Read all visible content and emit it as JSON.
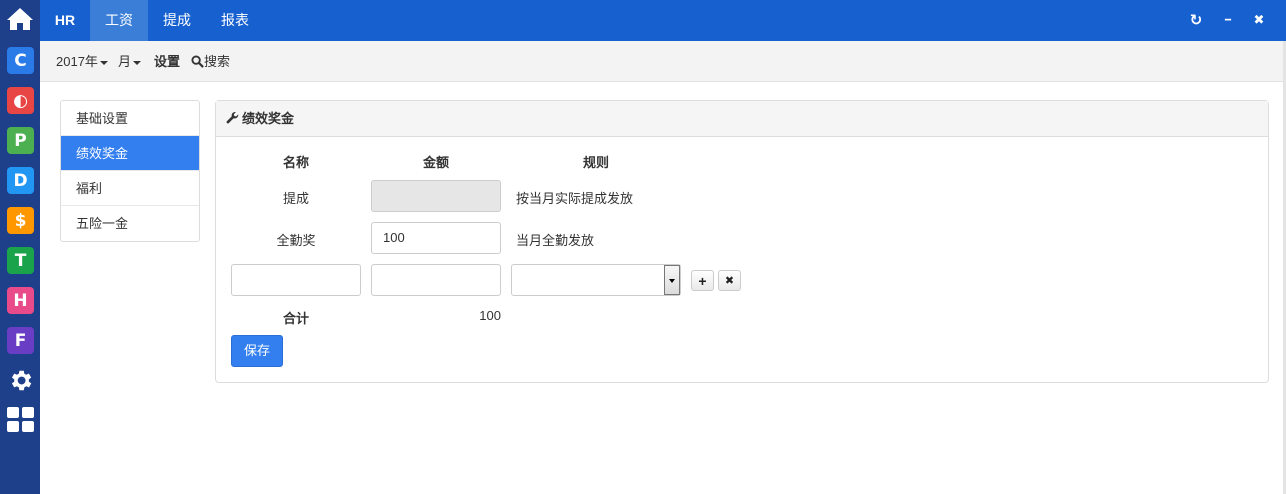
{
  "launcher": {
    "buttons": [
      {
        "glyph": "C",
        "color": "#2a7be8"
      },
      {
        "glyph": "◐",
        "color": "#e84545"
      },
      {
        "glyph": "P",
        "color": "#4caf50"
      },
      {
        "glyph": "D",
        "color": "#2196f3"
      },
      {
        "glyph": "$",
        "color": "#ff9800"
      },
      {
        "glyph": "T",
        "color": "#1aa34a"
      },
      {
        "glyph": "H",
        "color": "#e84a8a"
      },
      {
        "glyph": "F",
        "color": "#6a3ec4"
      }
    ]
  },
  "nav": {
    "brand": "HR",
    "tabs": [
      {
        "label": "工资",
        "active": true
      },
      {
        "label": "提成",
        "active": false
      },
      {
        "label": "报表",
        "active": false
      }
    ],
    "refresh_icon": "↻",
    "minimize_icon": "━",
    "close_icon": "✖"
  },
  "toolbar": {
    "year": "2017年",
    "month": "月",
    "settings": "设置",
    "search": "搜索"
  },
  "menu": {
    "items": [
      {
        "label": "基础设置",
        "active": false
      },
      {
        "label": "绩效奖金",
        "active": true
      },
      {
        "label": "福利",
        "active": false
      },
      {
        "label": "五险一金",
        "active": false
      }
    ]
  },
  "panel": {
    "title": "绩效奖金",
    "headers": {
      "name": "名称",
      "amount": "金额",
      "rule": "规则"
    },
    "rows": [
      {
        "name": "提成",
        "amount": "",
        "rule": "按当月实际提成发放",
        "disabled": true
      },
      {
        "name": "全勤奖",
        "amount": "100",
        "rule": "当月全勤发放",
        "disabled": false
      }
    ],
    "new_row": {
      "name": "",
      "amount": "",
      "rule": "",
      "add_icon": "+",
      "remove_icon": "✖"
    },
    "total_label": "合计",
    "total_value": "100",
    "save_label": "保存"
  }
}
